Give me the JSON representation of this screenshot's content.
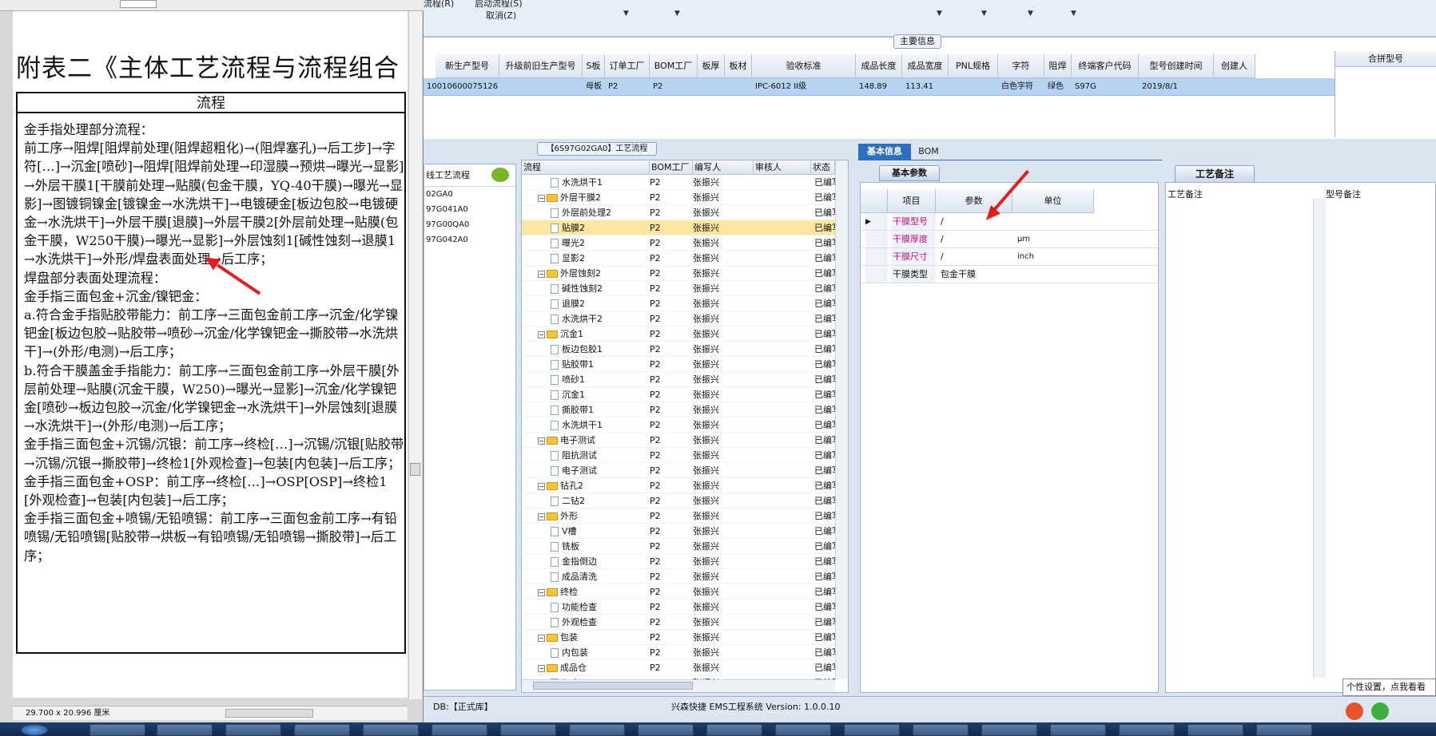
{
  "pdf": {
    "title": "附表二《主体工艺流程与流程组合",
    "table_header": "流程",
    "body_lines": [
      "金手指处理部分流程：",
      "前工序→阻焊[阻焊前处理(阻焊超粗化)→(阻焊塞孔)→后工步]→字符[…]→沉金[喷砂]→阻焊[阻焊前处理→印湿膜→预烘→曝光→显影]→外层干膜1[干膜前处理→贴膜(包金干膜，YQ-40干膜)→曝光→显影]→图镀铜镍金[镀镍金→水洗烘干]→电镀硬金[板边包胶→电镀硬金→水洗烘干]→外层干膜[退膜]→外层干膜2[外层前处理→贴膜(包金干膜，W250干膜)→曝光→显影]→外层蚀刻1[碱性蚀刻→退膜1→水洗烘干]→外形/焊盘表面处理→后工序；",
      "焊盘部分表面处理流程：",
      "金手指三面包金+沉金/镍钯金：",
      "a.符合金手指贴胶带能力：前工序→三面包金前工序→沉金/化学镍钯金[板边包胶→贴胶带→喷砂→沉金/化学镍钯金→撕胶带→水洗烘干]→(外形/电测)→后工序；",
      "b.符合干膜盖金手指能力：前工序→三面包金前工序→外层干膜[外层前处理→贴膜(沉金干膜，W250)→曝光→显影]→沉金/化学镍钯金[喷砂→板边包胶→沉金/化学镍钯金→水洗烘干]→外层蚀刻[退膜→水洗烘干]→(外形/电测)→后工序；",
      "金手指三面包金+沉锡/沉银：前工序→终检[…]→沉锡/沉银[贴胶带→沉锡/沉银→撕胶带]→终检1[外观检查]→包装[内包装]→后工序；",
      "金手指三面包金+OSP：前工序→终检[…]→OSP[OSP]→终检1[外观检查]→包装[内包装]→后工序；",
      "金手指三面包金+喷锡/无铅喷锡：前工序→三面包金前工序→有铅喷锡/无铅喷锡[贴胶带→烘板→有铅喷锡/无铅喷锡→撕胶带]→后工序；"
    ],
    "page_size": "29.700 x 20.996 厘米"
  },
  "top": {
    "label_flow": "流程(R)",
    "label_start": "启动流程(S)",
    "label_cancel": "取消(Z)"
  },
  "main_info": {
    "section_title": "主要信息",
    "headers": [
      "新生产型号",
      "升级前旧生产型号",
      "S板",
      "订单工厂",
      "BOM工厂",
      "板厚",
      "板材",
      "验收标准",
      "成品长度",
      "成品宽度",
      "PNL规格",
      "字符",
      "阻焊",
      "终端客户代码",
      "型号创建时间",
      "创建人"
    ],
    "row": [
      "10010600075126",
      "",
      "母板",
      "P2",
      "P2",
      "",
      "",
      "IPC-6012 II级",
      "148.89",
      "113.41",
      "",
      "白色字符",
      "绿色",
      "S97G",
      "2019/8/1",
      ""
    ],
    "merge_header": "合拼型号"
  },
  "flow_list": {
    "header": "线工艺流程",
    "items": [
      "02GA0",
      "97G041A0",
      "97G00QA0",
      "97G042A0"
    ]
  },
  "tree": {
    "title": "【6S97G02GA0】工艺流程",
    "headers": [
      "流程",
      "BOM工厂",
      "编写人",
      "审核人",
      "状态"
    ],
    "rows": [
      {
        "name": "水洗烘干1",
        "level": 2,
        "folder": false,
        "bom": "P2",
        "author": "张振兴",
        "status": "已编写"
      },
      {
        "name": "外层干膜2",
        "level": 1,
        "folder": true,
        "bom": "P2",
        "author": "张振兴",
        "status": "已编写"
      },
      {
        "name": "外层前处理2",
        "level": 2,
        "folder": false,
        "bom": "P2",
        "author": "张振兴",
        "status": "已编写"
      },
      {
        "name": "贴膜2",
        "level": 2,
        "folder": false,
        "bom": "P2",
        "author": "张振兴",
        "status": "已编写",
        "selected": true
      },
      {
        "name": "曝光2",
        "level": 2,
        "folder": false,
        "bom": "P2",
        "author": "张振兴",
        "status": "已编写"
      },
      {
        "name": "显影2",
        "level": 2,
        "folder": false,
        "bom": "P2",
        "author": "张振兴",
        "status": "已编写"
      },
      {
        "name": "外层蚀刻2",
        "level": 1,
        "folder": true,
        "bom": "P2",
        "author": "张振兴",
        "status": "已编写"
      },
      {
        "name": "碱性蚀刻2",
        "level": 2,
        "folder": false,
        "bom": "P2",
        "author": "张振兴",
        "status": "已编写"
      },
      {
        "name": "退膜2",
        "level": 2,
        "folder": false,
        "bom": "P2",
        "author": "张振兴",
        "status": "已编写"
      },
      {
        "name": "水洗烘干2",
        "level": 2,
        "folder": false,
        "bom": "P2",
        "author": "张振兴",
        "status": "已编写"
      },
      {
        "name": "沉金1",
        "level": 1,
        "folder": true,
        "bom": "P2",
        "author": "张振兴",
        "status": "已编写"
      },
      {
        "name": "板边包胶1",
        "level": 2,
        "folder": false,
        "bom": "P2",
        "author": "张振兴",
        "status": "已编写"
      },
      {
        "name": "贴胶带1",
        "level": 2,
        "folder": false,
        "bom": "P2",
        "author": "张振兴",
        "status": "已编写"
      },
      {
        "name": "喷砂1",
        "level": 2,
        "folder": false,
        "bom": "P2",
        "author": "张振兴",
        "status": "已编写"
      },
      {
        "name": "沉金1",
        "level": 2,
        "folder": false,
        "bom": "P2",
        "author": "张振兴",
        "status": "已编写"
      },
      {
        "name": "撕胶带1",
        "level": 2,
        "folder": false,
        "bom": "P2",
        "author": "张振兴",
        "status": "已编写"
      },
      {
        "name": "水洗烘干1",
        "level": 2,
        "folder": false,
        "bom": "P2",
        "author": "张振兴",
        "status": "已编写"
      },
      {
        "name": "电子测试",
        "level": 1,
        "folder": true,
        "bom": "P2",
        "author": "张振兴",
        "status": "已编写"
      },
      {
        "name": "阻抗测试",
        "level": 2,
        "folder": false,
        "bom": "P2",
        "author": "张振兴",
        "status": "已编写"
      },
      {
        "name": "电子测试",
        "level": 2,
        "folder": false,
        "bom": "P2",
        "author": "张振兴",
        "status": "已编写"
      },
      {
        "name": "钻孔2",
        "level": 1,
        "folder": true,
        "bom": "P2",
        "author": "张振兴",
        "status": "已编写"
      },
      {
        "name": "二钻2",
        "level": 2,
        "folder": false,
        "bom": "P2",
        "author": "张振兴",
        "status": "已编写"
      },
      {
        "name": "外形",
        "level": 1,
        "folder": true,
        "bom": "P2",
        "author": "张振兴",
        "status": "已编写"
      },
      {
        "name": "V槽",
        "level": 2,
        "folder": false,
        "bom": "P2",
        "author": "张振兴",
        "status": "已编写"
      },
      {
        "name": "铣板",
        "level": 2,
        "folder": false,
        "bom": "P2",
        "author": "张振兴",
        "status": "已编写"
      },
      {
        "name": "金指倒边",
        "level": 2,
        "folder": false,
        "bom": "P2",
        "author": "张振兴",
        "status": "已编写"
      },
      {
        "name": "成品清洗",
        "level": 2,
        "folder": false,
        "bom": "P2",
        "author": "张振兴",
        "status": "已编写"
      },
      {
        "name": "终检",
        "level": 1,
        "folder": true,
        "bom": "P2",
        "author": "张振兴",
        "status": "已编写"
      },
      {
        "name": "功能检查",
        "level": 2,
        "folder": false,
        "bom": "P2",
        "author": "张振兴",
        "status": "已编写"
      },
      {
        "name": "外观检查",
        "level": 2,
        "folder": false,
        "bom": "P2",
        "author": "张振兴",
        "status": "已编写"
      },
      {
        "name": "包装",
        "level": 1,
        "folder": true,
        "bom": "P2",
        "author": "张振兴",
        "status": "已编写"
      },
      {
        "name": "内包装",
        "level": 2,
        "folder": false,
        "bom": "P2",
        "author": "张振兴",
        "status": "已编写"
      },
      {
        "name": "成品仓",
        "level": 1,
        "folder": true,
        "bom": "P2",
        "author": "张振兴",
        "status": "已编写"
      },
      {
        "name": "入库",
        "level": 2,
        "folder": false,
        "bom": "P2",
        "author": "张振兴",
        "status": "已编写"
      }
    ]
  },
  "basic": {
    "tab_basic": "基本信息",
    "tab_bom": "BOM",
    "section": "基本参数",
    "headers": [
      "项目",
      "参数",
      "单位"
    ],
    "rows": [
      {
        "item": "干膜型号",
        "param": "/",
        "unit": "",
        "red": true,
        "current": true
      },
      {
        "item": "干膜厚度",
        "param": "/",
        "unit": "μm",
        "red": true
      },
      {
        "item": "干膜尺寸",
        "param": "/",
        "unit": "inch",
        "red": true
      },
      {
        "item": "干膜类型",
        "param": "包金干膜",
        "unit": "",
        "red": false
      }
    ]
  },
  "remark": {
    "title": "工艺备注",
    "col1": "工艺备注",
    "col2": "型号备注"
  },
  "status": {
    "db": "DB:【正式库】",
    "app": "兴森快捷 EMS工程系统 Version: 1.0.0.10",
    "tooltip": "个性设置，点我看看"
  },
  "colors": {
    "accent": "#2e6fbf",
    "red_label": "#c8107a",
    "arrow": "#e02020"
  }
}
